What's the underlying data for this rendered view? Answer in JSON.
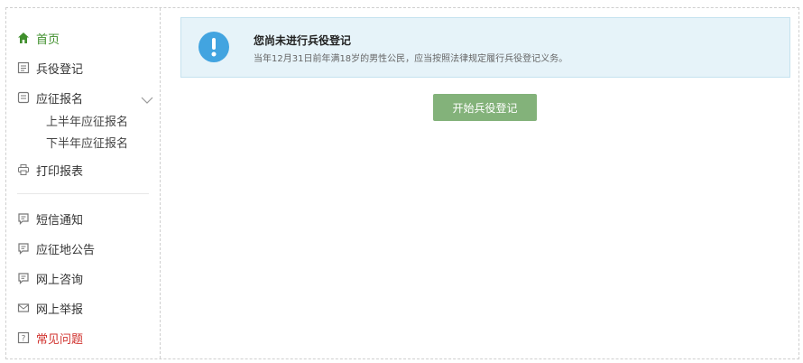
{
  "sidebar": {
    "items": [
      {
        "label": "首页",
        "icon": "home-icon"
      },
      {
        "label": "兵役登记",
        "icon": "document-icon"
      },
      {
        "label": "应征报名",
        "icon": "form-icon"
      },
      {
        "label": "打印报表",
        "icon": "printer-icon"
      },
      {
        "label": "短信通知",
        "icon": "message-icon"
      },
      {
        "label": "应征地公告",
        "icon": "message-icon"
      },
      {
        "label": "网上咨询",
        "icon": "message-icon"
      },
      {
        "label": "网上举报",
        "icon": "mail-icon"
      },
      {
        "label": "常见问题",
        "icon": "question-icon"
      }
    ],
    "sub_items": [
      "上半年应征报名",
      "下半年应征报名"
    ]
  },
  "notice": {
    "title": "您尚未进行兵役登记",
    "description": "当年12月31日前年满18岁的男性公民，应当按照法律规定履行兵役登记义务。"
  },
  "actions": {
    "start_label": "开始兵役登记"
  },
  "colors": {
    "active": "#3f8f2c",
    "danger": "#d0312d",
    "notice_bg": "#e6f3f9",
    "notice_badge": "#42a4e0",
    "button_bg": "#83b27a"
  }
}
